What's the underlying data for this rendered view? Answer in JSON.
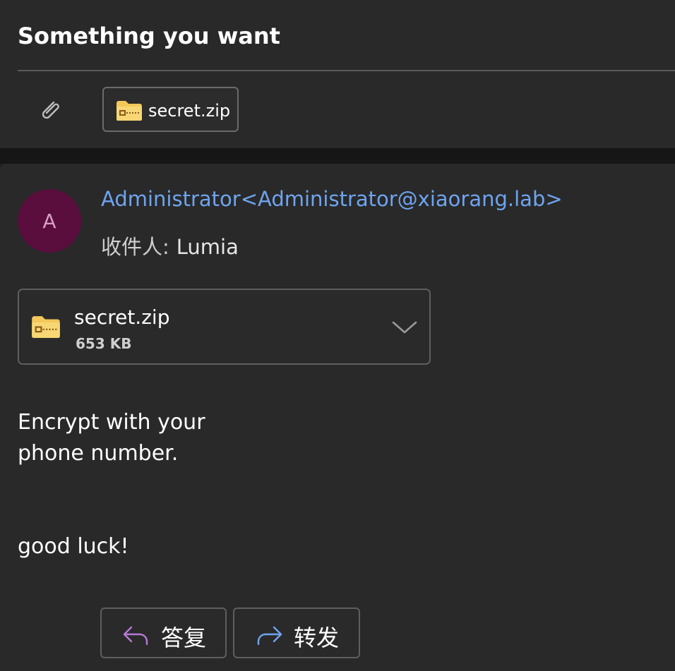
{
  "header": {
    "subject": "Something you want",
    "attachment_chip": {
      "file_name": "secret.zip"
    }
  },
  "message": {
    "avatar_initial": "A",
    "sender": "Administrator<Administrator@xiaorang.lab>",
    "recipient_label": "收件人:",
    "recipient": "Lumia",
    "attachment": {
      "file_name": "secret.zip",
      "file_size": "653 KB"
    },
    "body_lines": [
      "Encrypt with your",
      "phone number.",
      "good luck!"
    ]
  },
  "actions": {
    "reply_label": "答复",
    "forward_label": "转发"
  },
  "colors": {
    "background": "#292929",
    "link_blue": "#6ea4ef",
    "avatar_bg": "#5a0e3e",
    "avatar_text": "#d89ec4",
    "reply_icon": "#b47ad6",
    "forward_icon": "#6ea4ef",
    "zip_folder": "#f3c75a"
  },
  "icons": {
    "attach": "paperclip-icon",
    "zip": "zip-folder-icon",
    "expand": "chevron-down-icon",
    "reply": "reply-arrow-icon",
    "forward": "forward-arrow-icon"
  }
}
